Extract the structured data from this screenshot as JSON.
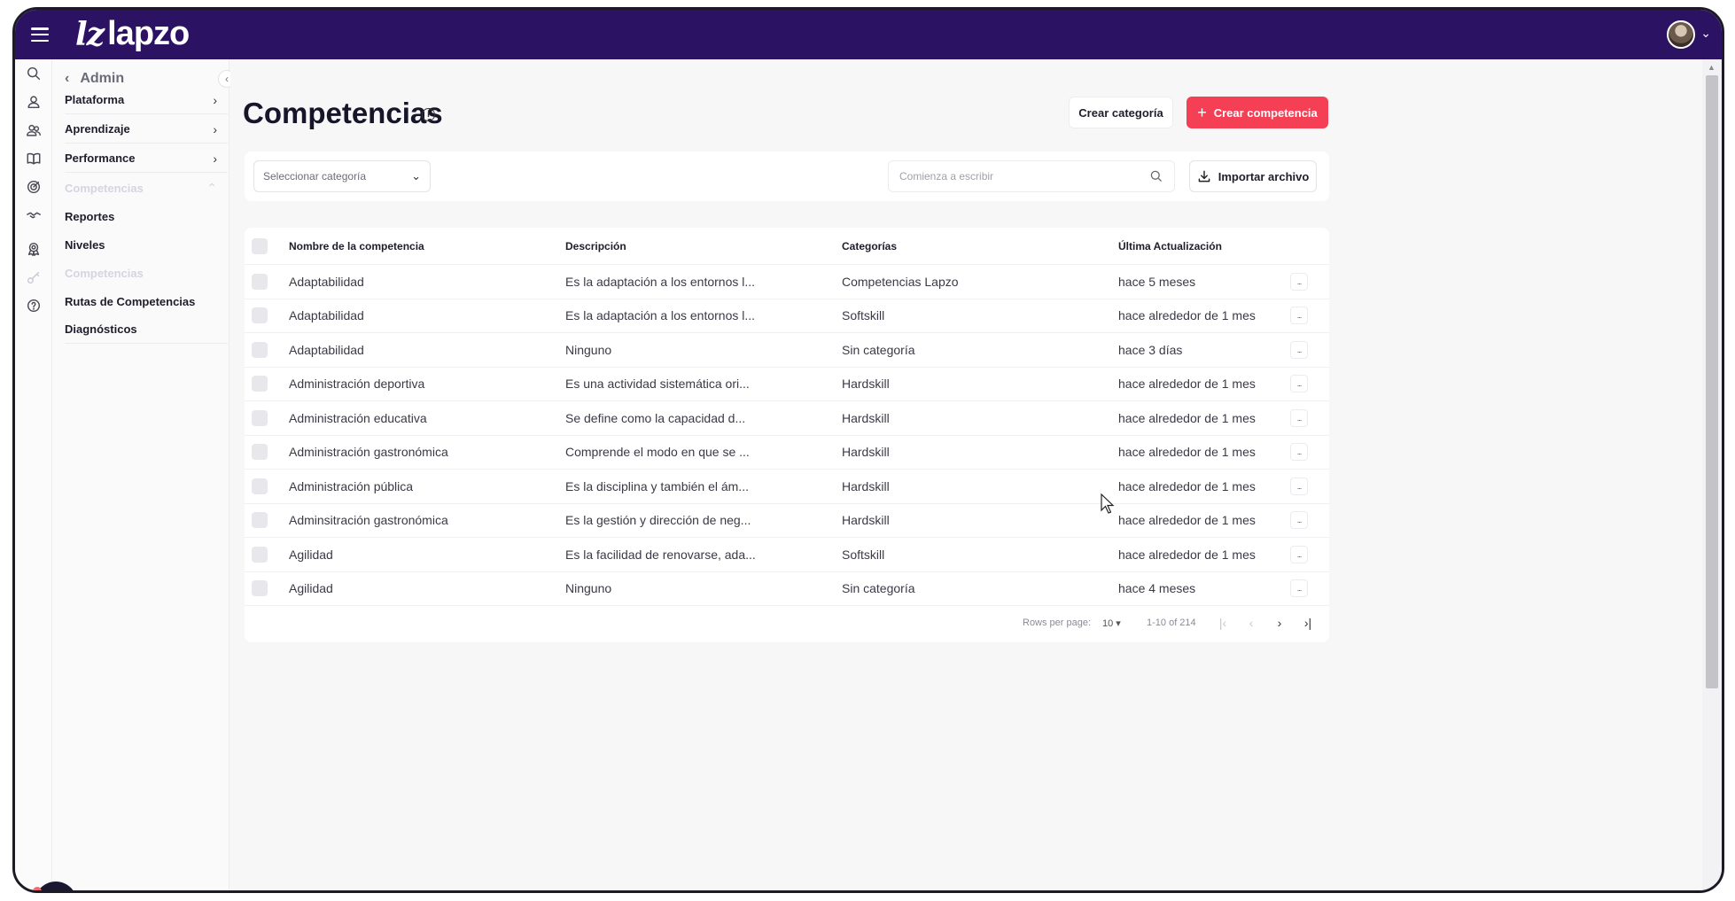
{
  "app": {
    "logo_text": "lapzo",
    "logo_mark": "lz"
  },
  "submenu": {
    "back_label": "Admin",
    "items": [
      {
        "label": "Plataforma",
        "has_chevron": true
      },
      {
        "label": "Aprendizaje",
        "has_chevron": true
      },
      {
        "label": "Performance",
        "has_chevron": true
      },
      {
        "label": "Competencias",
        "expanded": true
      }
    ],
    "subitems": [
      {
        "label": "Reportes"
      },
      {
        "label": "Niveles"
      },
      {
        "label": "Competencias",
        "active": true
      },
      {
        "label": "Rutas de Competencias"
      },
      {
        "label": "Diagnósticos"
      }
    ]
  },
  "page": {
    "title": "Competencias",
    "create_category_label": "Crear categoría",
    "create_competency_label": "Crear competencia",
    "category_select_label": "Seleccionar categoría",
    "search_placeholder": "Comienza a escribir",
    "import_label": "Importar archivo"
  },
  "table": {
    "headers": {
      "name": "Nombre de la competencia",
      "description": "Descripción",
      "categories": "Categorías",
      "updated": "Última Actualización"
    },
    "rows": [
      {
        "name": "Adaptabilidad",
        "description": "Es la adaptación a los entornos l...",
        "category": "Competencias Lapzo",
        "updated": "hace 5 meses"
      },
      {
        "name": "Adaptabilidad",
        "description": "Es la adaptación a los entornos l...",
        "category": "Softskill",
        "updated": "hace alrededor de 1 mes"
      },
      {
        "name": "Adaptabilidad",
        "description": "Ninguno",
        "category": "Sin categoría",
        "updated": "hace 3 días"
      },
      {
        "name": "Administración deportiva",
        "description": "Es una actividad sistemática ori...",
        "category": "Hardskill",
        "updated": "hace alrededor de 1 mes"
      },
      {
        "name": "Administración educativa",
        "description": "Se define como la capacidad d...",
        "category": "Hardskill",
        "updated": "hace alrededor de 1 mes"
      },
      {
        "name": "Administración gastronómica",
        "description": "Comprende el modo en que se ...",
        "category": "Hardskill",
        "updated": "hace alrededor de 1 mes"
      },
      {
        "name": "Administración pública",
        "description": "Es la disciplina y también el ám...",
        "category": "Hardskill",
        "updated": "hace alrededor de 1 mes"
      },
      {
        "name": "Adminsitración gastronómica",
        "description": "Es la gestión y dirección de neg...",
        "category": "Hardskill",
        "updated": "hace alrededor de 1 mes"
      },
      {
        "name": "Agilidad",
        "description": "Es la facilidad de renovarse, ada...",
        "category": "Softskill",
        "updated": "hace alrededor de 1 mes"
      },
      {
        "name": "Agilidad",
        "description": "Ninguno",
        "category": "Sin categoría",
        "updated": "hace 4 meses"
      }
    ],
    "row_menu_label": "..."
  },
  "pagination": {
    "rows_per_page_label": "Rows per page:",
    "rows_per_page": "10",
    "range": "1-10 of 214"
  },
  "colors": {
    "topbar": "#2b1263",
    "primary_button": "#f43f55",
    "faded_text": "#d5d5e0"
  }
}
